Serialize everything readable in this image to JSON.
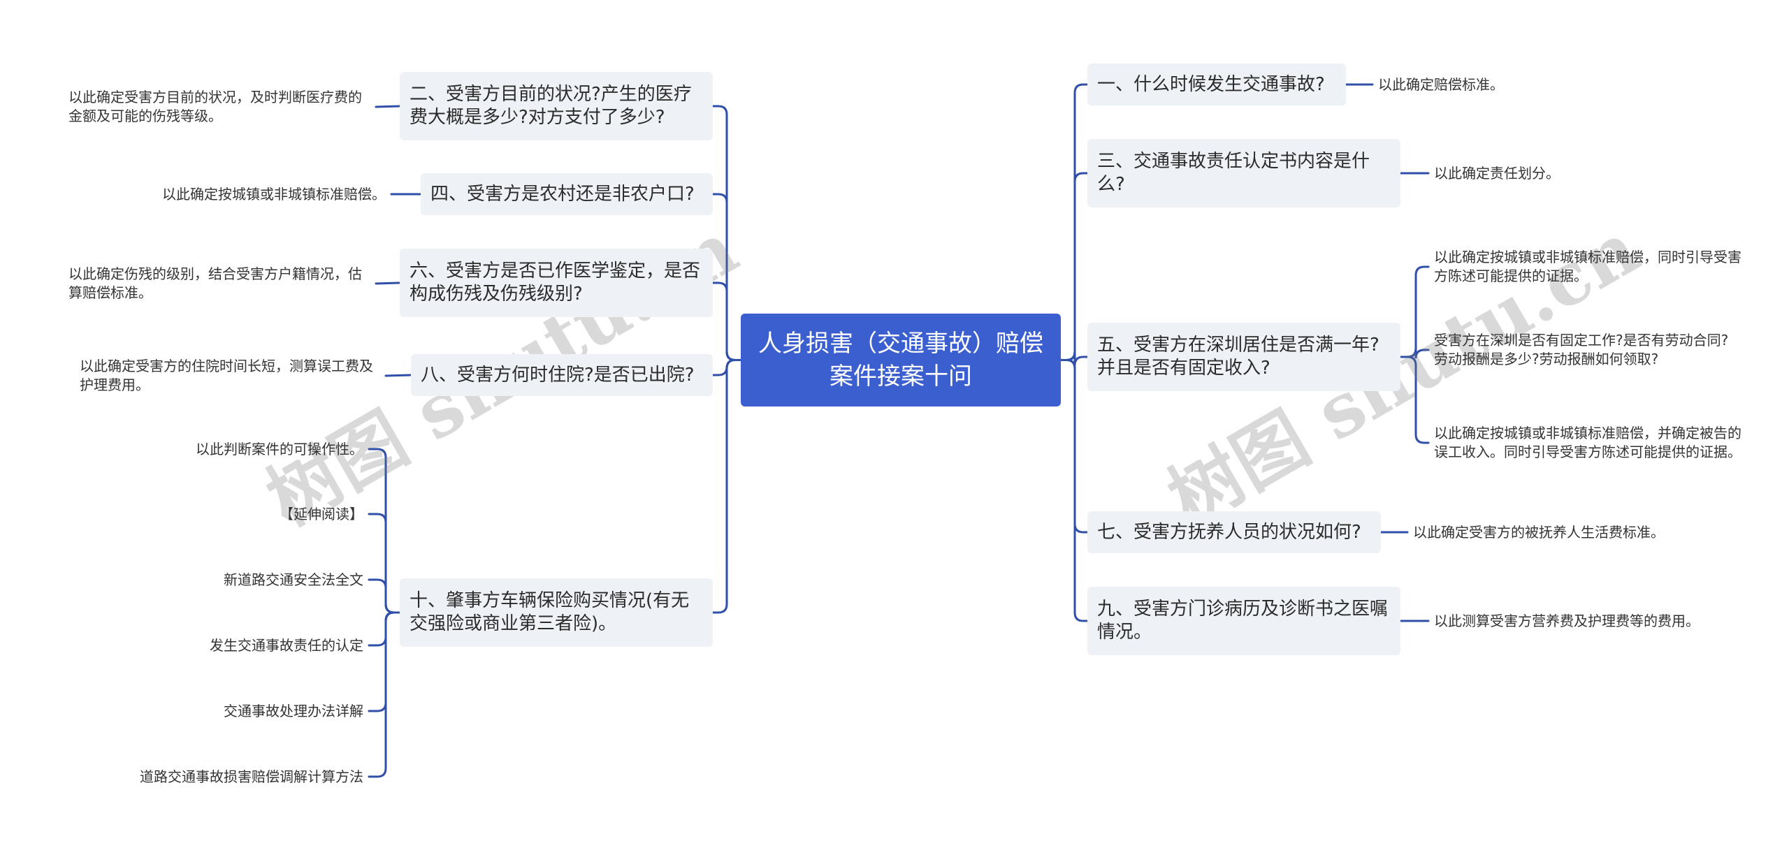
{
  "root": {
    "title": "人身损害（交通事故）赔偿案件接案十问"
  },
  "left_branches": [
    {
      "label": "二、受害方目前的状况?产生的医疗费大概是多少?对方支付了多少?",
      "children": [
        "以此确定受害方目前的状况，及时判断医疗费的金额及可能的伤残等级。"
      ]
    },
    {
      "label": "四、受害方是农村还是非农户口?",
      "children": [
        "以此确定按城镇或非城镇标准赔偿。"
      ]
    },
    {
      "label": "六、受害方是否已作医学鉴定，是否构成伤残及伤残级别?",
      "children": [
        "以此确定伤残的级别，结合受害方户籍情况，估算赔偿标准。"
      ]
    },
    {
      "label": "八、受害方何时住院?是否已出院?",
      "children": [
        "以此确定受害方的住院时间长短，测算误工费及护理费用。"
      ]
    },
    {
      "label": "十、肇事方车辆保险购买情况(有无交强险或商业第三者险)。",
      "children": [
        "以此判断案件的可操作性。",
        "【延伸阅读】",
        "新道路交通安全法全文",
        "发生交通事故责任的认定",
        "交通事故处理办法详解",
        "道路交通事故损害赔偿调解计算方法"
      ]
    }
  ],
  "right_branches": [
    {
      "label": "一、什么时候发生交通事故?",
      "children": [
        "以此确定赔偿标准。"
      ]
    },
    {
      "label": "三、交通事故责任认定书内容是什么?",
      "children": [
        "以此确定责任划分。"
      ]
    },
    {
      "label": "五、受害方在深圳居住是否满一年?并且是否有固定收入?",
      "children": [
        "以此确定按城镇或非城镇标准赔偿，同时引导受害方陈述可能提供的证据。",
        "受害方在深圳是否有固定工作?是否有劳动合同?劳动报酬是多少?劳动报酬如何领取?",
        "以此确定按城镇或非城镇标准赔偿，并确定被告的误工收入。同时引导受害方陈述可能提供的证据。"
      ]
    },
    {
      "label": "七、受害方抚养人员的状况如何?",
      "children": [
        "以此确定受害方的被抚养人生活费标准。"
      ]
    },
    {
      "label": "九、受害方门诊病历及诊断书之医嘱情况。",
      "children": [
        "以此测算受害方营养费及护理费等的费用。"
      ]
    }
  ],
  "watermarks": [
    "树图 shutu.cn",
    "树图 shutu.cn"
  ],
  "colors": {
    "root_fill": "#3c5fcf",
    "branch_fill": "#eef1f5",
    "connector": "#2f4fa8",
    "watermark": "#bdbdbd"
  }
}
